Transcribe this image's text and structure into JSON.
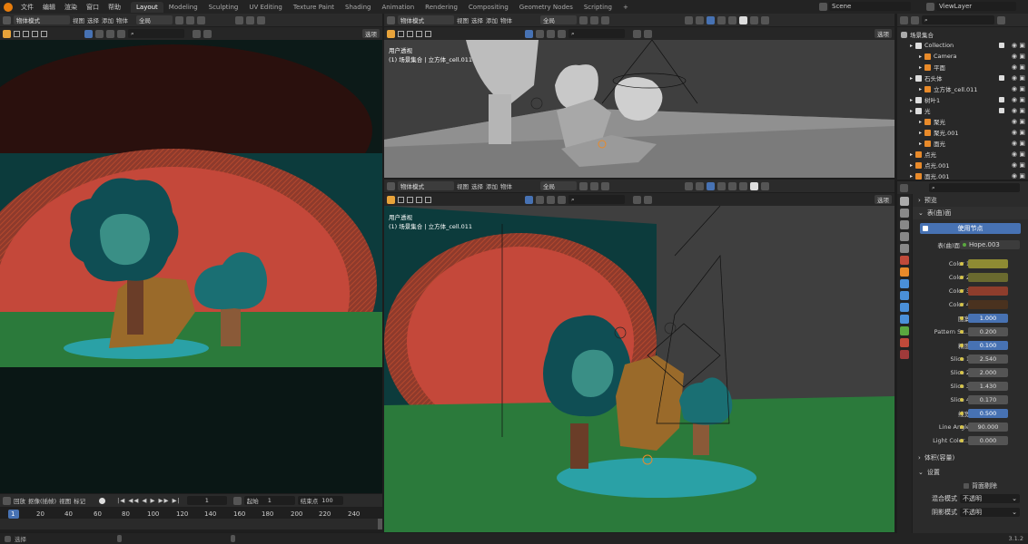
{
  "topbar": {
    "menus": [
      "文件",
      "编辑",
      "渲染",
      "窗口",
      "帮助"
    ],
    "workspaces": [
      "Layout",
      "Modeling",
      "Sculpting",
      "UV Editing",
      "Texture Paint",
      "Shading",
      "Animation",
      "Rendering",
      "Compositing",
      "Geometry Nodes",
      "Scripting"
    ],
    "active_workspace": "Layout",
    "add_tab_icon": "+",
    "scene": "Scene",
    "view_layer": "ViewLayer"
  },
  "left_view": {
    "mode": "物体模式",
    "menus": [
      "视图",
      "选择",
      "添加",
      "物体"
    ],
    "orientation": "全局",
    "options": "选项"
  },
  "top_view": {
    "mode": "物体模式",
    "menus": [
      "视图",
      "选择",
      "添加",
      "物体"
    ],
    "orientation": "全局",
    "options": "选项",
    "overlay_title": "用户透视",
    "overlay_sub": "(1) 场景集合 | 立方体_cell.011"
  },
  "bottom_view": {
    "mode": "物体模式",
    "menus": [
      "视图",
      "选择",
      "添加",
      "物体"
    ],
    "orientation": "全局",
    "options": "选项",
    "overlay_title": "用户透视",
    "overlay_sub": "(1) 场景集合 | 立方体_cell.011"
  },
  "timeline": {
    "menus": [
      "回放",
      "抠像(插帧)",
      "视图",
      "标记"
    ],
    "current_frame": "1",
    "start_label": "起始",
    "start": "1",
    "end_label": "结束点",
    "end": "100",
    "ticks": [
      "1",
      "20",
      "40",
      "60",
      "80",
      "100",
      "120",
      "140",
      "160",
      "180",
      "200",
      "220",
      "240"
    ]
  },
  "status_bar": {
    "select": "选择",
    "version": "3.1.2"
  },
  "outliner": {
    "title": "场景集合",
    "items": [
      {
        "label": "Collection",
        "indent": 1,
        "icon": "collection-icon",
        "chk": true
      },
      {
        "label": "Camera",
        "indent": 2,
        "icon": "camera-icon",
        "chk": false
      },
      {
        "label": "平面",
        "indent": 2,
        "icon": "mesh-icon",
        "chk": false
      },
      {
        "label": "石头体",
        "indent": 1,
        "icon": "collection-icon",
        "chk": true
      },
      {
        "label": "立方体_cell.011",
        "indent": 2,
        "icon": "mesh-icon",
        "chk": false
      },
      {
        "label": "树叶1",
        "indent": 1,
        "icon": "collection-icon",
        "chk": true
      },
      {
        "label": "光",
        "indent": 1,
        "icon": "collection-icon",
        "chk": true
      },
      {
        "label": "聚光",
        "indent": 2,
        "icon": "light-icon",
        "chk": false
      },
      {
        "label": "聚光.001",
        "indent": 2,
        "icon": "light-icon",
        "chk": false
      },
      {
        "label": "面光",
        "indent": 2,
        "icon": "light-icon",
        "chk": false
      },
      {
        "label": "点光",
        "indent": 1,
        "icon": "light-icon",
        "chk": false
      },
      {
        "label": "点光.001",
        "indent": 1,
        "icon": "light-icon",
        "chk": false
      },
      {
        "label": "面光.001",
        "indent": 1,
        "icon": "light-icon",
        "chk": false
      }
    ]
  },
  "properties": {
    "preview": "预览",
    "surface_section": "表(曲)面",
    "use_nodes": "使用节点",
    "surface_label": "表(曲)面",
    "surface_value": "Hope.003",
    "rows": [
      {
        "label": "Color 1",
        "type": "color",
        "color": "#8e8b33"
      },
      {
        "label": "Color 2",
        "type": "color",
        "color": "#6a6a2f"
      },
      {
        "label": "Color 3",
        "type": "color",
        "color": "#8e3d2c"
      },
      {
        "label": "Color 4",
        "type": "color",
        "color": "#4a321f"
      },
      {
        "label": "图案",
        "type": "num",
        "value": "1.000",
        "sel": true
      },
      {
        "label": "Pattern Sc...",
        "type": "num",
        "value": "0.200",
        "sel": false
      },
      {
        "label": "精度",
        "type": "num",
        "value": "0.100",
        "sel": true
      },
      {
        "label": "Slice 1",
        "type": "num",
        "value": "2.540",
        "sel": false
      },
      {
        "label": "Slice 2",
        "type": "num",
        "value": "2.000",
        "sel": false
      },
      {
        "label": "Slice 3",
        "type": "num",
        "value": "1.430",
        "sel": false
      },
      {
        "label": "Slice 4",
        "type": "num",
        "value": "0.170",
        "sel": false
      },
      {
        "label": "线宽",
        "type": "num",
        "value": "0.500",
        "sel": true
      },
      {
        "label": "Line Angle",
        "type": "num",
        "value": "90.000",
        "sel": false
      },
      {
        "label": "Light Color...",
        "type": "num",
        "value": "0.000",
        "sel": false
      }
    ],
    "volume_section": "体积(容量)",
    "settings_section": "设置",
    "backface": "背面剔除",
    "blend_label": "混合模式",
    "blend_value": "不透明",
    "shadow_label": "阴影模式",
    "shadow_value": "不透明"
  }
}
